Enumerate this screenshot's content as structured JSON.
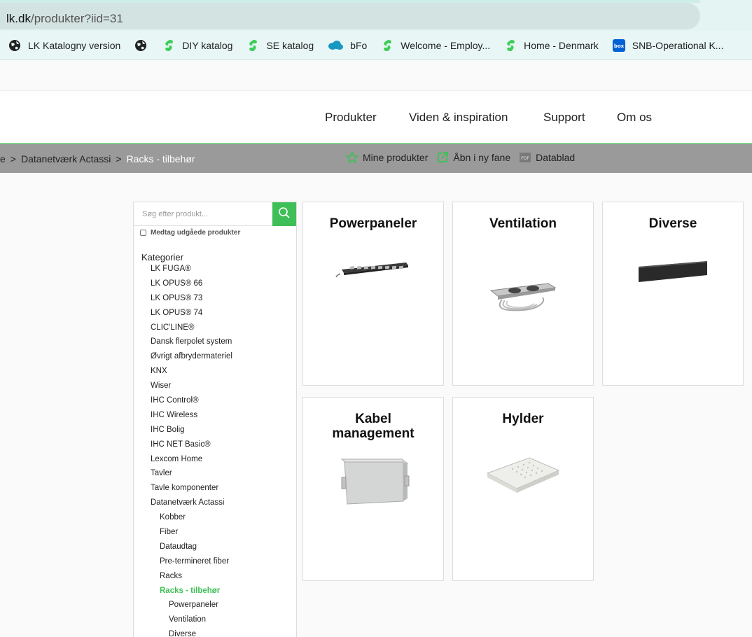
{
  "browser": {
    "url_host": "lk.dk",
    "url_path": "/produkter?iid=31",
    "bookmarks": [
      {
        "label": "LK Katalogny version",
        "icon": "globe-icon"
      },
      {
        "label": "",
        "icon": "globe-icon"
      },
      {
        "label": "DIY katalog",
        "icon": "schneider-icon"
      },
      {
        "label": "SE katalog",
        "icon": "schneider-icon"
      },
      {
        "label": "bFo",
        "icon": "cloud-icon"
      },
      {
        "label": "Welcome - Employ...",
        "icon": "schneider-icon"
      },
      {
        "label": "Home - Denmark",
        "icon": "schneider-icon"
      },
      {
        "label": "SNB-Operational K...",
        "icon": "box-icon"
      }
    ],
    "box_icon_text": "box",
    "colors": {
      "schneider_green": "#3dcd58",
      "salesforce_blue": "#1798c1",
      "box_blue": "#0061d5"
    }
  },
  "nav": {
    "items": [
      "Produkter",
      "Viden & inspiration",
      "Support",
      "Om os"
    ]
  },
  "breadcrumb": {
    "items": [
      "e",
      "Datanetværk Actassi"
    ],
    "current": "Racks - tilbehør",
    "separator": ">"
  },
  "tools": {
    "my_products": "Mine produkter",
    "open_tab": "Åbn i ny fane",
    "datasheet": "Datablad",
    "pdf_text": "PDF"
  },
  "sidebar": {
    "search_placeholder": "Søg efter produkt...",
    "include_discontinued": "Medtag udgåede produkter",
    "categories_title": "Kategorier",
    "categories": [
      {
        "label": "LK FUGA®",
        "level": 1
      },
      {
        "label": "LK OPUS® 66",
        "level": 1
      },
      {
        "label": "LK OPUS® 73",
        "level": 1
      },
      {
        "label": "LK OPUS® 74",
        "level": 1
      },
      {
        "label": "CLIC'LINE®",
        "level": 1
      },
      {
        "label": "Dansk flerpolet system",
        "level": 1
      },
      {
        "label": "Øvrigt afbrydermateriel",
        "level": 1
      },
      {
        "label": "KNX",
        "level": 1
      },
      {
        "label": "Wiser",
        "level": 1
      },
      {
        "label": "IHC Control®",
        "level": 1
      },
      {
        "label": "IHC Wireless",
        "level": 1
      },
      {
        "label": "IHC Bolig",
        "level": 1
      },
      {
        "label": "IHC NET Basic®",
        "level": 1
      },
      {
        "label": "Lexcom Home",
        "level": 1
      },
      {
        "label": "Tavler",
        "level": 1
      },
      {
        "label": "Tavle komponenter",
        "level": 1
      },
      {
        "label": "Datanetværk Actassi",
        "level": 1
      },
      {
        "label": "Kobber",
        "level": 2
      },
      {
        "label": "Fiber",
        "level": 2
      },
      {
        "label": "Dataudtag",
        "level": 2
      },
      {
        "label": "Pre-termineret fiber",
        "level": 2
      },
      {
        "label": "Racks",
        "level": 2
      },
      {
        "label": "Racks - tilbehør",
        "level": 2,
        "active": true
      },
      {
        "label": "Powerpaneler",
        "level": 3
      },
      {
        "label": "Ventilation",
        "level": 3
      },
      {
        "label": "Diverse",
        "level": 3
      }
    ]
  },
  "cards": [
    {
      "title": "Powerpaneler",
      "image": "power-strip-image"
    },
    {
      "title": "Ventilation",
      "image": "fan-unit-image"
    },
    {
      "title": "Diverse",
      "image": "blank-panel-image"
    },
    {
      "title": "Kabel management",
      "image": "cable-box-image"
    },
    {
      "title": "Hylder",
      "image": "shelf-image"
    }
  ],
  "accent_color": "#3fbf57"
}
